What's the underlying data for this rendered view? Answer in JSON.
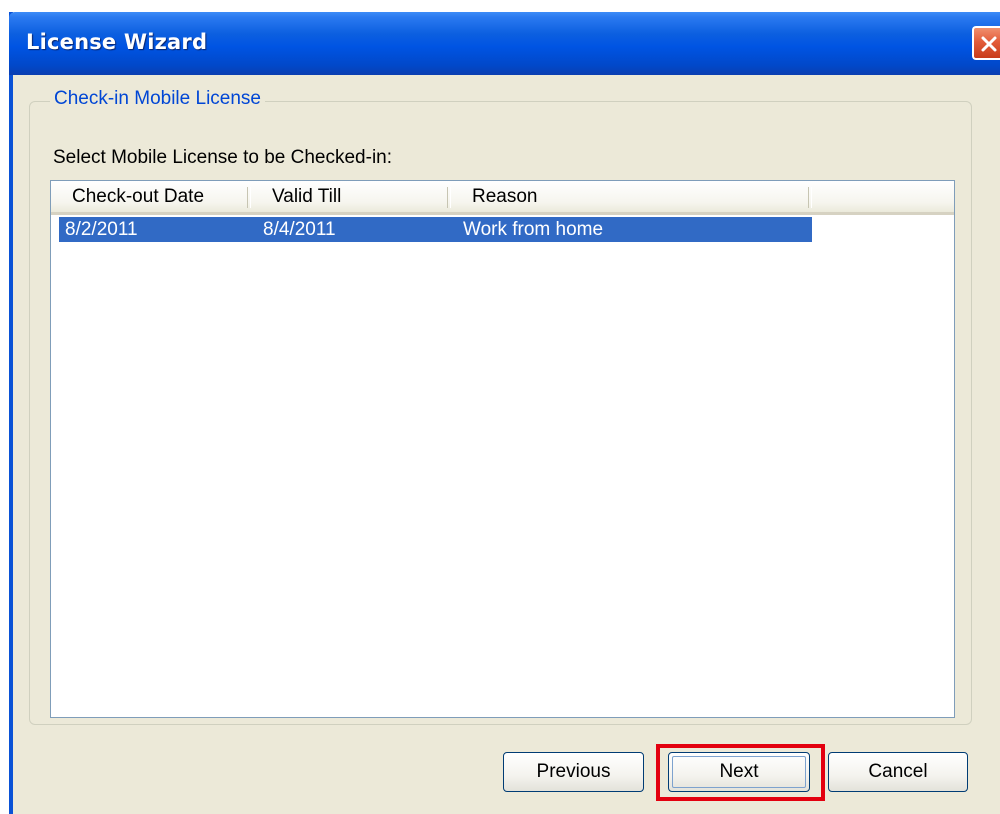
{
  "window": {
    "title": "License Wizard",
    "close_icon": "close-icon"
  },
  "group": {
    "legend": "Check-in Mobile License"
  },
  "prompt": {
    "label": "Select Mobile License to be Checked-in:"
  },
  "listview": {
    "columns": [
      "Check-out Date",
      "Valid Till",
      "Reason"
    ],
    "rows": [
      {
        "checkout_date": "8/2/2011",
        "valid_till": "8/4/2011",
        "reason": "Work from home",
        "selected": true
      }
    ]
  },
  "buttons": {
    "previous": "Previous",
    "next": "Next",
    "cancel": "Cancel"
  },
  "colors": {
    "titlebar": "#0054e3",
    "selection": "#316ac5",
    "legend_text": "#0046d5",
    "highlight": "#e3000f"
  }
}
